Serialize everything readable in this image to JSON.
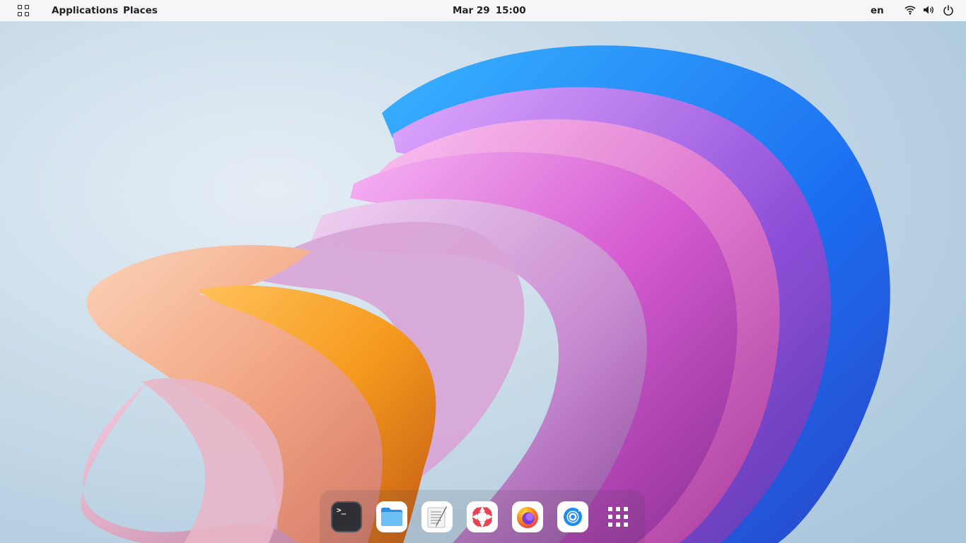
{
  "topbar": {
    "activities_icon": "activities-grid-icon",
    "applications_label": "Applications",
    "places_label": "Places",
    "clock_date": "Mar 29",
    "clock_time": "15:00",
    "language": "en",
    "status_icons": [
      "wifi-icon",
      "volume-icon",
      "power-icon"
    ]
  },
  "dock": {
    "items": [
      {
        "icon": "terminal-icon"
      },
      {
        "icon": "files-icon"
      },
      {
        "icon": "text-editor-icon"
      },
      {
        "icon": "help-lifebuoy-icon"
      },
      {
        "icon": "firefox-icon"
      },
      {
        "icon": "web-browser-icon"
      },
      {
        "icon": "show-applications-icon"
      }
    ],
    "terminal_prompt": ">_"
  },
  "colors": {
    "topbar_bg": "#f6f6f8",
    "wallpaper_bg": "#c9dbe8",
    "accent_blue": "#1e8cf0",
    "accent_pink": "#e07ad0",
    "accent_orange": "#f59a1e"
  }
}
